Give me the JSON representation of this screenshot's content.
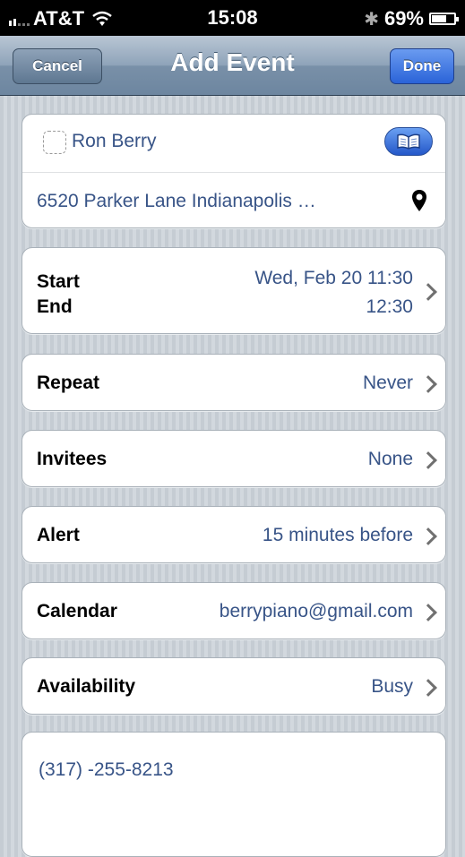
{
  "status_bar": {
    "carrier": "AT&T",
    "time": "15:08",
    "battery": "69%",
    "battery_level": 0.69,
    "icons": [
      "signal-icon",
      "wifi-icon",
      "bluetooth-icon",
      "battery-icon"
    ]
  },
  "nav": {
    "title": "Add Event",
    "cancel_label": "Cancel",
    "done_label": "Done"
  },
  "contact": {
    "name": "Ron Berry",
    "address": "6520 Parker Lane Indianapolis …",
    "icons": [
      "contacts-book-icon",
      "location-pin-icon"
    ]
  },
  "time": {
    "start_label": "Start",
    "end_label": "End",
    "start_value": "Wed, Feb 20  11:30",
    "end_value": "12:30"
  },
  "rows": {
    "repeat": {
      "label": "Repeat",
      "value": "Never"
    },
    "invitees": {
      "label": "Invitees",
      "value": "None"
    },
    "alert": {
      "label": "Alert",
      "value": "15 minutes before"
    },
    "calendar": {
      "label": "Calendar",
      "value": "berrypiano@gmail.com"
    },
    "availability": {
      "label": "Availability",
      "value": "Busy"
    }
  },
  "notes": {
    "text": "(317) -255-8213"
  },
  "colors": {
    "value_blue": "#385487",
    "done_blue": "#2a63d8",
    "nav_gray": "#7990a8"
  }
}
